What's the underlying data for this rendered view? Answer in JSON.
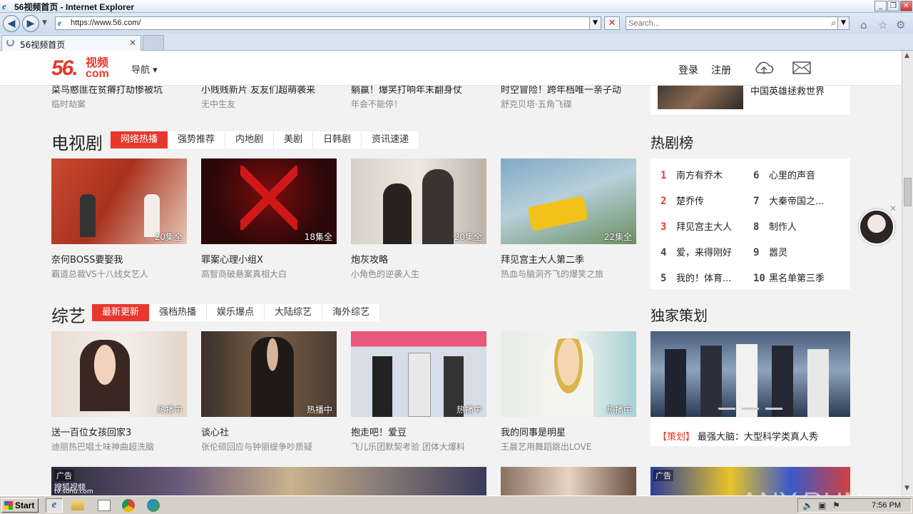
{
  "window": {
    "title": "56视频首页 - Internet Explorer"
  },
  "browser": {
    "url": "https://www.56.com/",
    "search_placeholder": "Search...",
    "tab_label": "56视频首页"
  },
  "site": {
    "logo_num": "56.",
    "logo_text_top": "视频",
    "logo_text_bottom": "com",
    "nav_label": "导航 ▾",
    "login": "登录",
    "register": "注册"
  },
  "top_row": [
    {
      "title": "菜鸟憨匪在贫瘠打劫惨被坑",
      "sub": "临时劫案"
    },
    {
      "title": "小贱贱新片 友友们超萌袭来",
      "sub": "无中生友"
    },
    {
      "title": "躺赢！爆笑打响年末翻身仗",
      "sub": "年会不能停！"
    },
    {
      "title": "时空冒险！跨年档唯一亲子动",
      "sub": "舒克贝塔·五角飞碟"
    }
  ],
  "top_side_caption": "中国英雄拯救世界",
  "tv": {
    "title": "电视剧",
    "tabs": [
      "网络热播",
      "强势推荐",
      "内地剧",
      "美剧",
      "日韩剧",
      "资讯速递"
    ],
    "cards": [
      {
        "title": "奈何BOSS要娶我",
        "sub": "霸道总裁VS十八线女艺人",
        "badge": "20集全"
      },
      {
        "title": "罪案心理小组X",
        "sub": "高智商破悬案真相大白",
        "badge": "18集全"
      },
      {
        "title": "炮灰攻略",
        "sub": "小角色的逆袭人生",
        "badge": "20集全"
      },
      {
        "title": "拜见宫主大人第二季",
        "sub": "热血与脑洞齐飞的爆笑之旅",
        "badge": "22集全"
      }
    ]
  },
  "hotlist": {
    "title": "热剧榜",
    "items": [
      {
        "n": "1",
        "name": "南方有乔木"
      },
      {
        "n": "2",
        "name": "楚乔传"
      },
      {
        "n": "3",
        "name": "拜见宫主大人"
      },
      {
        "n": "4",
        "name": "爱，来得刚好"
      },
      {
        "n": "5",
        "name": "我的！体育..."
      },
      {
        "n": "6",
        "name": "心里的声音"
      },
      {
        "n": "7",
        "name": "大秦帝国之..."
      },
      {
        "n": "8",
        "name": "制作人"
      },
      {
        "n": "9",
        "name": "嚣灵"
      },
      {
        "n": "10",
        "name": "黑名单第三季"
      }
    ]
  },
  "variety": {
    "title": "综艺",
    "tabs": [
      "最新更新",
      "强档热播",
      "娱乐爆点",
      "大陆综艺",
      "海外综艺"
    ],
    "cards": [
      {
        "title": "送一百位女孩回家3",
        "sub": "迪丽热巴唱土味神曲超洗脑",
        "badge": "热播中"
      },
      {
        "title": "谈心社",
        "sub": "张伦硕回应与钟丽缇争吵质疑",
        "badge": "热播中"
      },
      {
        "title": "抱走吧！爱豆",
        "sub": "飞儿乐团默契考验 团体大爆料",
        "badge": "热播中"
      },
      {
        "title": "我的同事是明星",
        "sub": "王晨艺用舞蹈跳出LOVE",
        "badge": "热播中"
      }
    ]
  },
  "exclusive": {
    "title": "独家策划",
    "tag": "【策划】",
    "caption": "最强大脑：大型科学类真人秀"
  },
  "ads": {
    "label1": "广告",
    "label2": "广告",
    "sohu": "搜狐视频",
    "sohu_url": "tv.sohu.com"
  },
  "taskbar": {
    "start": "Start",
    "clock": "7:56 PM"
  },
  "watermark": "ANY.RUN"
}
